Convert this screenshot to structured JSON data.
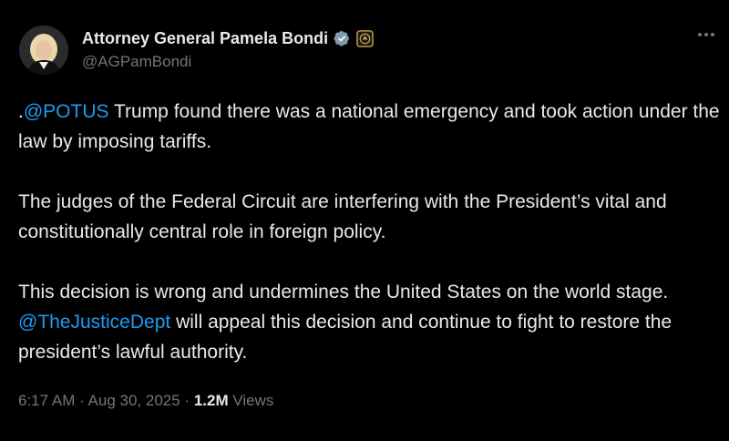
{
  "author": {
    "display_name": "Attorney General Pamela Bondi",
    "handle": "@AGPamBondi",
    "verified_badge_icon": "verified-checkmark-icon",
    "affiliation_badge_icon": "government-seal-icon",
    "badge_color": "#829aab"
  },
  "tweet": {
    "p1_prefix": ".",
    "p1_mention": "@POTUS",
    "p1_rest": " Trump found there was a national emergency and took action under the law by imposing tariffs.",
    "p2": "The judges of the Federal Circuit are interfering with the President’s vital and constitutionally central role in foreign policy.",
    "p3_before": "This decision is wrong and undermines the United States on the world stage. ",
    "p3_mention": "@TheJusticeDept",
    "p3_after": " will appeal this decision and continue to fight to restore the president’s lawful authority."
  },
  "meta": {
    "time": "6:17 AM",
    "separator": " · ",
    "date": "Aug 30, 2025",
    "views_count": "1.2M",
    "views_label": " Views"
  },
  "colors": {
    "background": "#000000",
    "text": "#e7e9ea",
    "secondary": "#71767b",
    "link": "#1d9bf0"
  },
  "more_menu_icon": "more-horizontal-icon"
}
